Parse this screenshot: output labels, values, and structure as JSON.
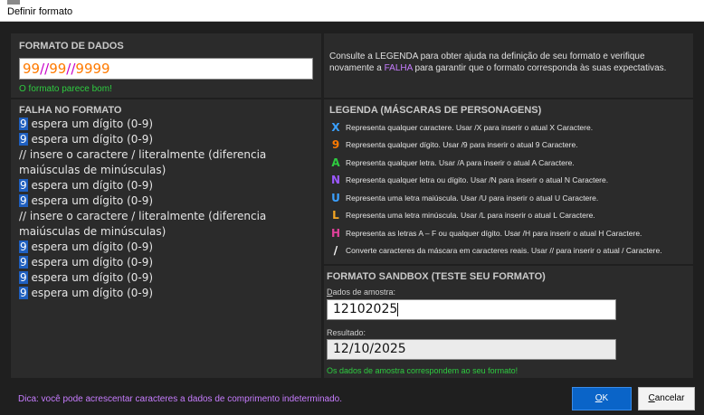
{
  "window": {
    "title": "Definir formato"
  },
  "format_panel": {
    "heading": "FORMATO DE DADOS",
    "input_tokens": [
      {
        "text": "99",
        "kind": "digit"
      },
      {
        "text": "//",
        "kind": "slash"
      },
      {
        "text": "99",
        "kind": "digit"
      },
      {
        "text": "//",
        "kind": "slash"
      },
      {
        "text": "9999",
        "kind": "digit"
      }
    ],
    "status": "O formato parece bom!"
  },
  "help": {
    "text_before": "Consulte a LEGENDA para obter ajuda na definição de seu formato e verifique novamente a ",
    "falha": "FALHA",
    "text_after": " para garantir que o formato corresponda às suas expectativas."
  },
  "fail_panel": {
    "heading": "FALHA NO FORMATO",
    "rows": [
      {
        "token": "9",
        "text": " espera um dígito (0-9)"
      },
      {
        "token": "9",
        "text": " espera um dígito (0-9)"
      },
      {
        "token": "",
        "text": "// insere o caractere / literalmente (diferencia maiúsculas de minúsculas)"
      },
      {
        "token": "9",
        "text": " espera um dígito (0-9)"
      },
      {
        "token": "9",
        "text": " espera um dígito (0-9)"
      },
      {
        "token": "",
        "text": "// insere o caractere / literalmente (diferencia maiúsculas de minúsculas)"
      },
      {
        "token": "9",
        "text": " espera um dígito (0-9)"
      },
      {
        "token": "9",
        "text": " espera um dígito (0-9)"
      },
      {
        "token": "9",
        "text": " espera um dígito (0-9)"
      },
      {
        "token": "9",
        "text": " espera um dígito (0-9)"
      }
    ]
  },
  "legend": {
    "heading": "LEGENDA (MÁSCARAS DE PERSONAGENS)",
    "items": [
      {
        "symbol": "X",
        "color": "#3aa0ff",
        "text": "Representa qualquer caractere.  Usar /X  para inserir o atual X  Caractere."
      },
      {
        "symbol": "9",
        "color": "#ff7a00",
        "text": "Representa qualquer dígito.  Usar /9  para inserir o atual 9  Caractere."
      },
      {
        "symbol": "A",
        "color": "#2ecc40",
        "text": "Representa qualquer letra.  Usar /A  para inserir o atual A  Caractere."
      },
      {
        "symbol": "N",
        "color": "#9b59ff",
        "text": "Representa qualquer letra ou dígito.  Usar /N  para inserir o atual N  Caractere."
      },
      {
        "symbol": "U",
        "color": "#3aa0ff",
        "text": "Representa uma letra maiúscula.  Usar /U  para inserir o atual U  Caractere."
      },
      {
        "symbol": "L",
        "color": "#f5a623",
        "text": "Representa uma letra minúscula.  Usar /L  para inserir o atual L  Caractere."
      },
      {
        "symbol": "H",
        "color": "#e0409a",
        "text": "Representa as letras A – F ou qualquer dígito.  Usar /H  para inserir o atual H  Caractere."
      },
      {
        "symbol": "/",
        "color": "#ffffff",
        "text": "Converte caracteres da máscara em caracteres reais.  Usar //  para inserir o atual /  Caractere."
      }
    ]
  },
  "sandbox": {
    "heading": "FORMATO SANDBOX (TESTE SEU FORMATO)",
    "sample_label_underlined": "D",
    "sample_label_rest": "ados de amostra:",
    "sample_value": "12102025",
    "result_label": "Resultado:",
    "result_value": "12/10/2025",
    "status": "Os dados de amostra correspondem ao seu formato!"
  },
  "footer": {
    "tip": "Dica: você pode acrescentar caracteres a dados de comprimento indeterminado.",
    "ok_underlined": "O",
    "ok_rest": "K",
    "cancel_underlined": "C",
    "cancel_rest": "ancelar"
  },
  "colors": {
    "background": "#1f1f1f",
    "panel": "#2b2b2b",
    "digit_mask": "#ff7a00",
    "slash_mask": "#c800c8",
    "token_highlight": "#1f5fbf",
    "success": "#2ecc40",
    "tip": "#c77dff",
    "primary_button": "#0a64c8"
  }
}
